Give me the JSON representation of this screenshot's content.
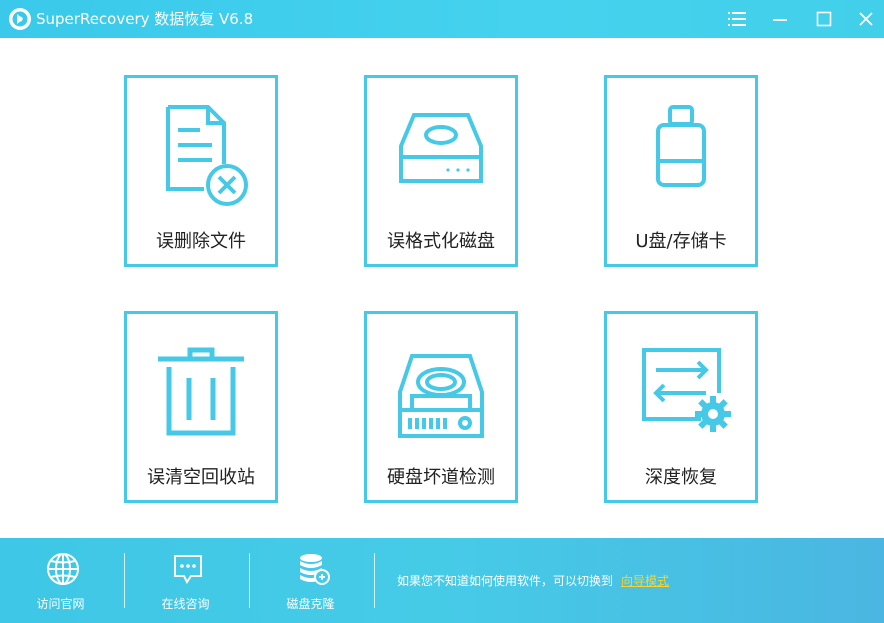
{
  "window": {
    "title": "SuperRecovery 数据恢复 V6.8",
    "controls": [
      {
        "name": "menu-button",
        "icon": "hamburger-menu-icon"
      },
      {
        "name": "minimize-button",
        "icon": "minimize-icon"
      },
      {
        "name": "maximize-button",
        "icon": "maximize-icon"
      },
      {
        "name": "close-button",
        "icon": "close-icon"
      }
    ]
  },
  "modes": [
    {
      "label": "误删除文件",
      "icon": "deleted-file-icon"
    },
    {
      "label": "误格式化磁盘",
      "icon": "hard-disk-icon"
    },
    {
      "label": "U盘/存储卡",
      "icon": "usb-drive-icon"
    },
    {
      "label": "误清空回收站",
      "icon": "recycle-bin-icon"
    },
    {
      "label": "硬盘坏道检测",
      "icon": "disk-check-icon"
    },
    {
      "label": "深度恢复",
      "icon": "deep-recovery-icon"
    }
  ],
  "footer": {
    "buttons": [
      {
        "label": "访问官网",
        "icon": "globe-icon"
      },
      {
        "label": "在线咨询",
        "icon": "chat-icon"
      },
      {
        "label": "磁盘克隆",
        "icon": "database-clone-icon"
      }
    ],
    "tip_text": "如果您不知道如何使用软件，可以切换到",
    "tip_link": "向导模式"
  },
  "colors": {
    "accent": "#45c9e6",
    "title_bar": "#3ac9ea",
    "footer": "#46cbe7",
    "link": "#ffd320"
  }
}
